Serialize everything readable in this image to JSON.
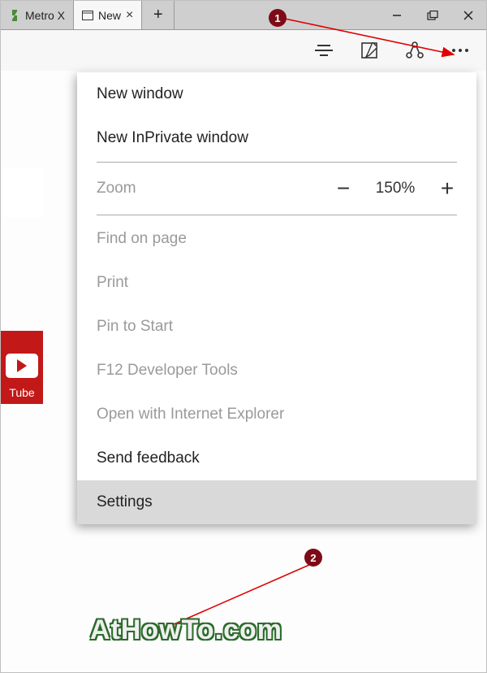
{
  "tabs": {
    "items": [
      {
        "title": "Metro X",
        "active": false
      },
      {
        "title": "New",
        "active": true
      }
    ]
  },
  "window_controls": {
    "minimize": "–",
    "maximize": "❐",
    "close": "✕"
  },
  "toolbar": {
    "reading_list": "reading-list",
    "notes": "notes",
    "share": "share",
    "more": "more"
  },
  "menu": {
    "new_window": "New window",
    "new_inprivate": "New InPrivate window",
    "zoom_label": "Zoom",
    "zoom_value": "150%",
    "find": "Find on page",
    "print": "Print",
    "pin": "Pin to Start",
    "devtools": "F12 Developer Tools",
    "open_ie": "Open with Internet Explorer",
    "feedback": "Send feedback",
    "settings": "Settings"
  },
  "left": {
    "youtube_label": "Tube"
  },
  "annotations": {
    "step1": "1",
    "step2": "2"
  },
  "watermark": "AtHowTo.com"
}
